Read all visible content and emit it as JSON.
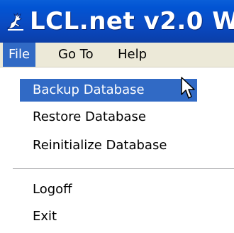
{
  "window": {
    "title": "LCL.net v2.0 W",
    "icon": "deer-icon"
  },
  "menubar": {
    "items": [
      {
        "label": "File",
        "open": true
      },
      {
        "label": "Go To"
      },
      {
        "label": "Help"
      }
    ]
  },
  "file_menu": {
    "items": [
      {
        "label": "Backup Database",
        "highlighted": true
      },
      {
        "label": "Restore Database"
      },
      {
        "label": "Reinitialize Database"
      },
      {
        "label": "Logoff"
      },
      {
        "label": "Exit"
      }
    ]
  },
  "colors": {
    "titlebar": "#0a4bc3",
    "menubar": "#ece9d8",
    "highlight": "#316ac5"
  },
  "cursor": "arrow-cursor-icon"
}
